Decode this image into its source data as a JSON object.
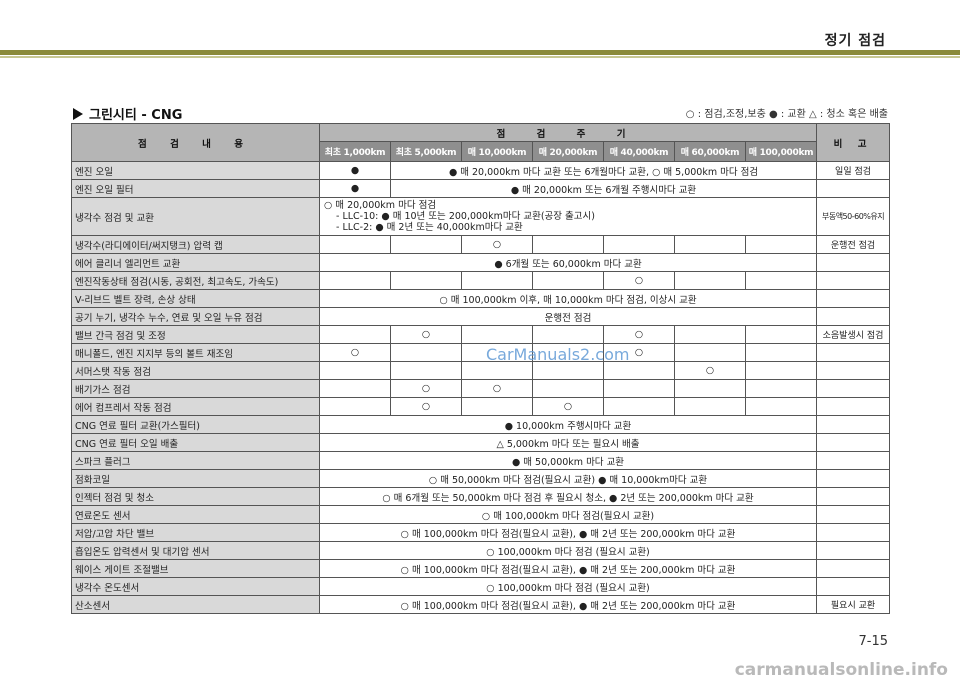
{
  "header": {
    "section_title": "정기 점검"
  },
  "heading": "그린시티 - CNG",
  "legend": "○ : 점검,조정,보충  ● : 교환  △ : 청소 혹은 배출",
  "table": {
    "col_item": "점 검 내 용",
    "col_period": "점 검 주 기",
    "col_note": "비 고",
    "intervals": [
      "최초 1,000km",
      "최초 5,000km",
      "매 10,000km",
      "매 20,000km",
      "매 40,000km",
      "매 60,000km",
      "매 100,000km"
    ],
    "rows": [
      {
        "item": "엔진 오일",
        "c1": "●",
        "span": "● 매 20,000km 마다 교환 또는 6개월마다 교환, ○ 매 5,000km 마다 점검",
        "note": "일일 점검"
      },
      {
        "item": "엔진 오일 필터",
        "c1": "●",
        "span": "● 매 20,000km 또는 6개월 주행시마다 교환",
        "note": ""
      },
      {
        "item": "냉각수 점검 및 교환",
        "multi": [
          "○ 매 20,000km 마다 점검",
          "- LLC-10: ● 매 10년 또는 200,000km마다 교환(공장 출고시)",
          "- LLC-2: ● 매 2년 또는 40,000km마다 교환"
        ],
        "note": "부동액50-60%유지"
      },
      {
        "item": "냉각수(라디에이터/써지탱크) 압력 캡",
        "c3": "○",
        "note": "운행전 점검"
      },
      {
        "item": "에어 클리너 엘리먼트 교환",
        "span": "● 6개월 또는 60,000km 마다 교환",
        "note": ""
      },
      {
        "item": "엔진작동상태 점검(시동, 공회전, 최고속도, 가속도)",
        "c4": "○",
        "note": ""
      },
      {
        "item": "V-리브드 벨트 장력, 손상 상태",
        "span": "○ 매 100,000km 이후, 매 10,000km 마다 점검, 이상시 교환",
        "note": ""
      },
      {
        "item": "공기 누기, 냉각수 누수, 연료 및 오일 누유 점검",
        "span": "운행전 점검",
        "note": ""
      },
      {
        "item": "밸브 간극 점검 및 조정",
        "c2": "○",
        "c4": "○",
        "note": "소음발생시 점검"
      },
      {
        "item": "매니폴드, 엔진 지지부 등의 볼트 재조임",
        "c1": "○",
        "c4": "○",
        "note": ""
      },
      {
        "item": "서머스탯 작동 점검",
        "c5": "○",
        "note": ""
      },
      {
        "item": "배기가스 점검",
        "c2": "○",
        "c3": "○",
        "note": ""
      },
      {
        "item": "에어 컴프레서 작동 점검",
        "c2": "○",
        "c4": "○",
        "note": ""
      },
      {
        "item": "CNG 연료 필터 교환(가스필터)",
        "span": "● 10,000km 주행시마다 교환",
        "note": ""
      },
      {
        "item": "CNG 연료 필터 오일 배출",
        "span": "△ 5,000km 마다 또는 필요시 배출",
        "note": ""
      },
      {
        "item": "스파크 플러그",
        "span": "● 매 50,000km 마다 교환",
        "note": ""
      },
      {
        "item": "점화코일",
        "span": "○ 매 50,000km 마다 점검(필요시 교환) ● 매 10,000km마다 교환",
        "note": ""
      },
      {
        "item": "인젝터 점검 및 청소",
        "span": "○ 매 6개월 또는 50,000km 마다 점검 후 필요시 청소, ● 2년 또는 200,000km 마다 교환",
        "note": ""
      },
      {
        "item": "연료온도 센서",
        "span": "○ 매 100,000km 마다 점검(필요시 교환)",
        "note": ""
      },
      {
        "item": "저압/고압 차단 밸브",
        "span": "○ 매 100,000km 마다 점검(필요시 교환), ● 매 2년 또는 200,000km 마다 교환",
        "note": ""
      },
      {
        "item": "흡입온도 압력센서 및 대기압 센서",
        "span": "○ 100,000km 마다 점검 (필요시 교환)",
        "note": ""
      },
      {
        "item": "웨이스 게이트 조절밸브",
        "span": "○ 매 100,000km 마다 점검(필요시 교환), ● 매 2년 또는 200,000km 마다 교환",
        "note": ""
      },
      {
        "item": "냉각수 온도센서",
        "span": "○ 100,000km 마다 점검 (필요시 교환)",
        "note": ""
      },
      {
        "item": "산소센서",
        "span": "○ 매 100,000km 마다 점검(필요시 교환), ● 매 2년 또는 200,000km 마다 교환",
        "note": "필요시 교환"
      }
    ]
  },
  "watermark": "CarManuals2.com",
  "page_number": "7-15",
  "footer_mark": "carmanualsonline.info"
}
